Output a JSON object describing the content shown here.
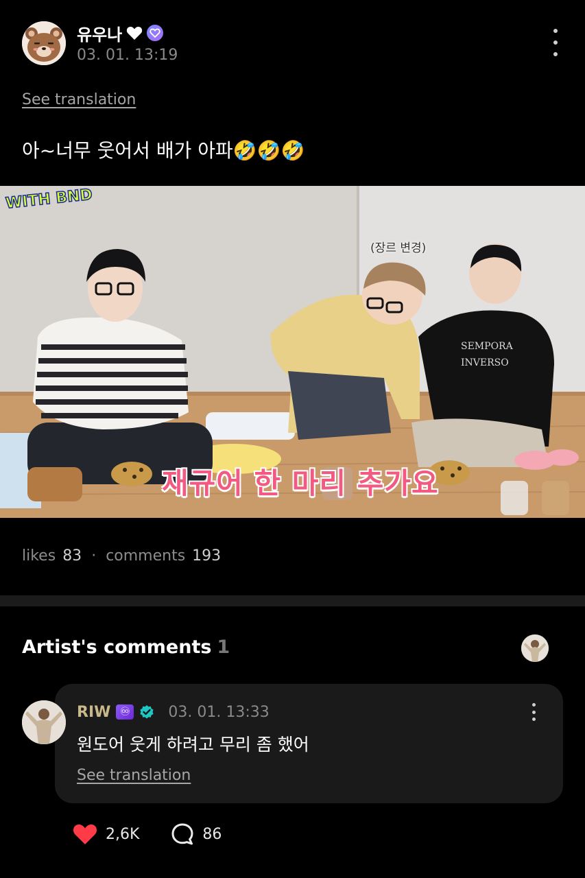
{
  "post": {
    "author": "유우나",
    "timestamp": "03. 01. 13:19",
    "see_translation": "See translation",
    "text": "아~너무 웃어서 배가 아파🤣🤣🤣",
    "icons": {
      "avatar": "bear-avatar",
      "heart": "heart-icon",
      "badge": "membership-badge-icon",
      "menu": "more-vertical-icon"
    }
  },
  "video": {
    "logo": "WITH BND",
    "caption_small": "(장르 변경)",
    "caption_big": "재규어 한 마리 추가요"
  },
  "stats": {
    "likes_label": "likes",
    "likes_count": "83",
    "separator": "·",
    "comments_label": "comments",
    "comments_count": "193"
  },
  "artist_comments": {
    "title": "Artist's comments",
    "count": "1",
    "comment": {
      "name": "RIW",
      "badge": "♾",
      "time": "03. 01. 13:33",
      "text": "원도어 웃게 하려고 무리 좀 했어",
      "see_translation": "See translation"
    }
  },
  "actions": {
    "likes": "2,6K",
    "comments": "86"
  },
  "colors": {
    "background": "#000000",
    "card": "#1a1a1a",
    "accent_heart": "#ff3b47",
    "artist_name": "#c9b98a",
    "caption": "#f25a82"
  }
}
